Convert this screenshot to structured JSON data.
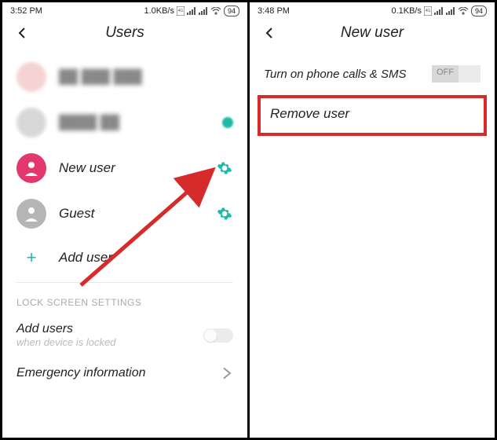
{
  "left": {
    "status": {
      "time": "3:52 PM",
      "net": "1.0KB/s",
      "battery": "94"
    },
    "title": "Users",
    "users": [
      {
        "label": "----",
        "blurred": true
      },
      {
        "label": "----",
        "blurred": true
      },
      {
        "label": "New user",
        "gear": true,
        "avatar": "pink"
      },
      {
        "label": "Guest",
        "gear": true,
        "avatar": "gray"
      }
    ],
    "add_user": "Add user",
    "section": "LOCK SCREEN SETTINGS",
    "add_users_title": "Add users",
    "add_users_sub": "when device is locked",
    "emergency": "Emergency information"
  },
  "right": {
    "status": {
      "time": "3:48 PM",
      "net": "0.1KB/s",
      "battery": "94"
    },
    "title": "New user",
    "phone_sms": "Turn on phone calls & SMS",
    "toggle_label": "OFF",
    "remove": "Remove user"
  }
}
